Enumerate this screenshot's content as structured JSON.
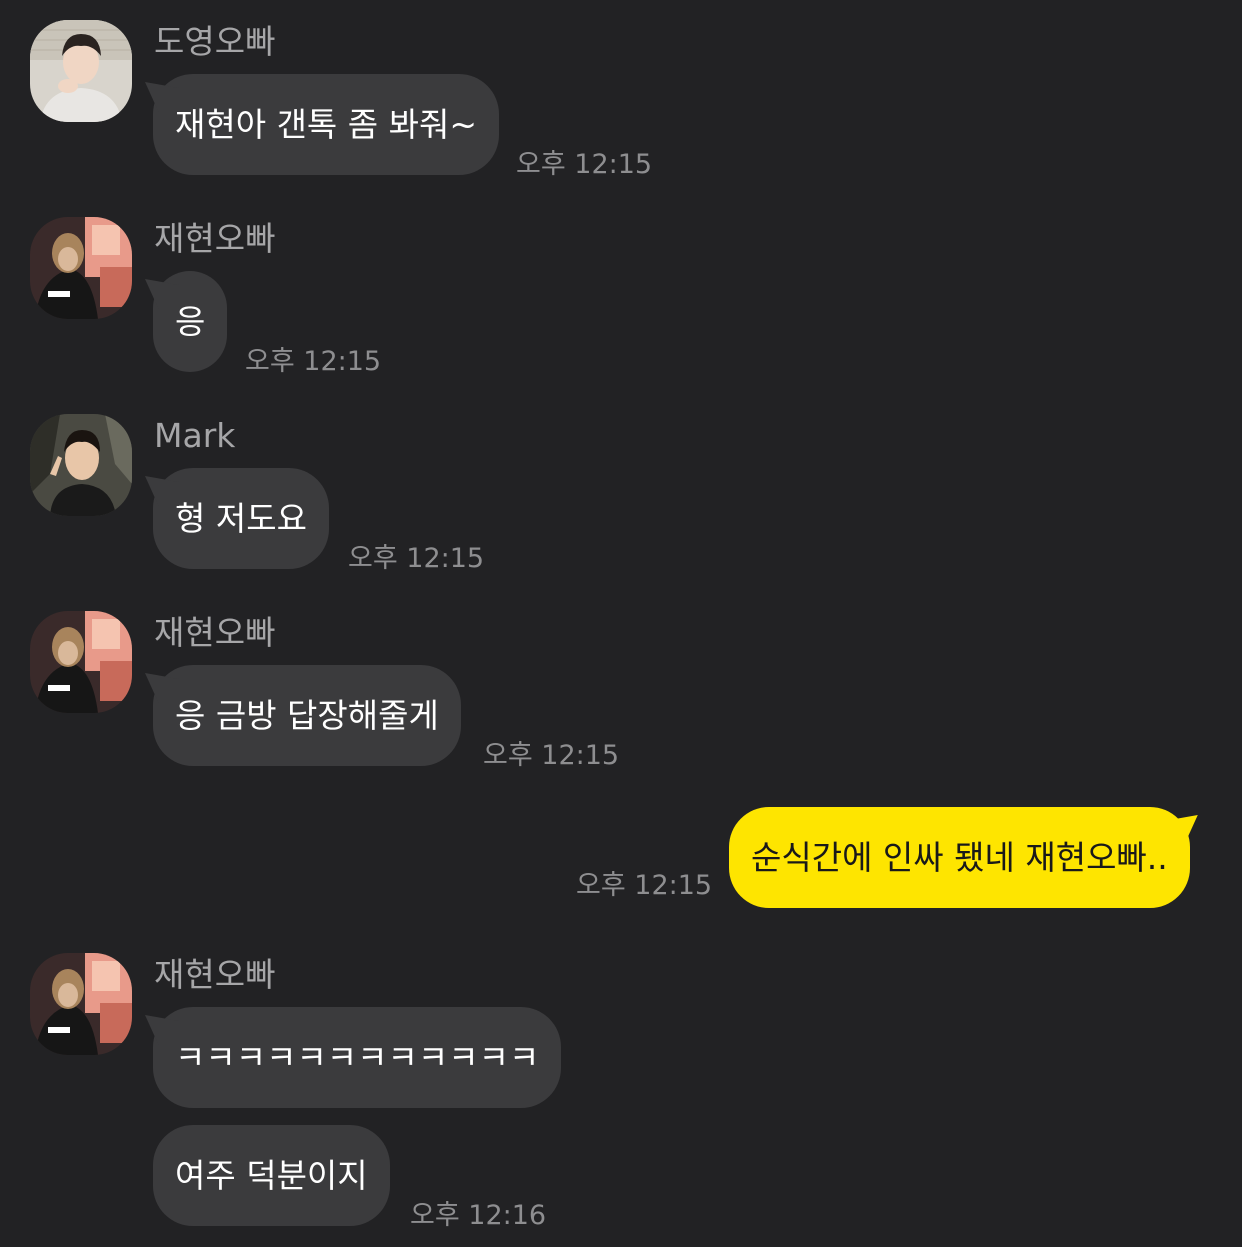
{
  "messages": [
    {
      "sender": "도영오빠",
      "text": "재현아 갠톡 좀 봐줘~",
      "time": "오후 12:15"
    },
    {
      "sender": "재현오빠",
      "text": "응",
      "time": "오후 12:15"
    },
    {
      "sender": "Mark",
      "text": "형 저도요",
      "time": "오후 12:15"
    },
    {
      "sender": "재현오빠",
      "text": "응 금방 답장해줄게",
      "time": "오후 12:15"
    },
    {
      "sender": "me",
      "text": "순식간에 인싸 됐네 재현오빠..",
      "time": "오후 12:15"
    },
    {
      "sender": "재현오빠",
      "text": "ㅋㅋㅋㅋㅋㅋㅋㅋㅋㅋㅋㅋ",
      "time": null
    },
    {
      "sender": "재현오빠",
      "text": "여주 덕분이지",
      "time": "오후 12:16"
    }
  ],
  "colors": {
    "background": "#222224",
    "incoming_bubble": "#3b3b3d",
    "outgoing_bubble": "#fee500",
    "sender_text": "#a6a6a8",
    "time_text": "#8e8e90"
  },
  "avatars": [
    "doyoung-avatar",
    "jaehyun-avatar",
    "mark-avatar"
  ]
}
